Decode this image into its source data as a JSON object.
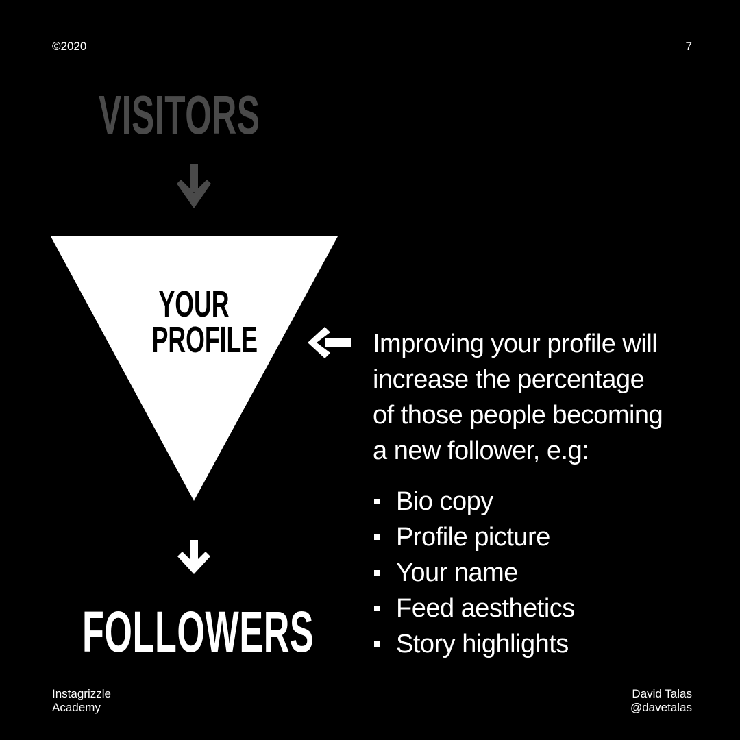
{
  "header": {
    "copyright": "©2020",
    "page_number": "7"
  },
  "funnel": {
    "top_label": "VISITORS",
    "middle_label_line1": "YOUR",
    "middle_label_line2": "PROFILE",
    "bottom_label": "FOLLOWERS",
    "colors": {
      "background": "#000000",
      "triangle": "#ffffff",
      "muted": "#4a4a4a",
      "text": "#ffffff"
    }
  },
  "explanation": {
    "lines": [
      "Improving your profile will",
      "increase the percentage",
      "of those people becoming",
      "a new follower, e.g:"
    ],
    "items": [
      "Bio copy",
      "Profile picture",
      "Your name",
      "Feed aesthetics",
      "Story highlights"
    ]
  },
  "footer": {
    "brand_line1": "Instagrizzle",
    "brand_line2": "Academy",
    "author_name": "David Talas",
    "author_handle": "@davetalas"
  }
}
